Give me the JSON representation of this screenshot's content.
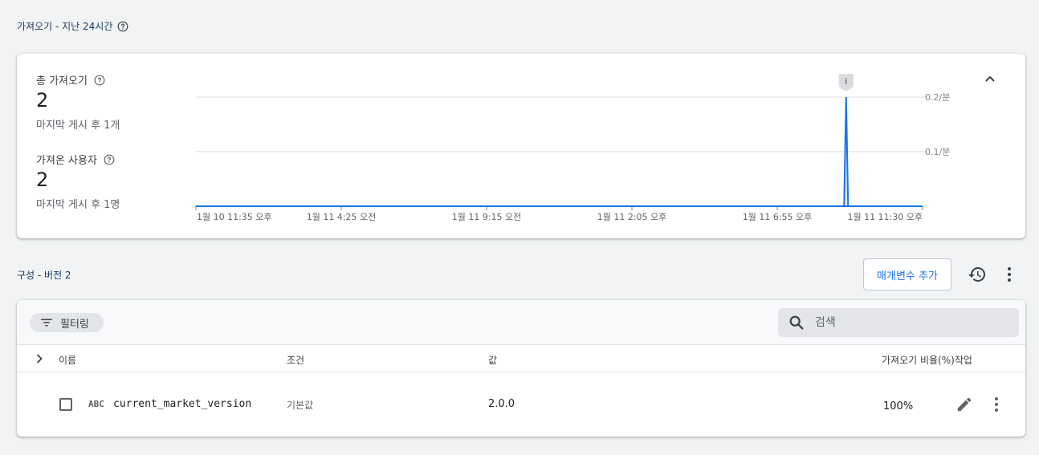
{
  "fetch_section": {
    "title": "가져오기 - 지난 24시간"
  },
  "stats": {
    "total_fetches": {
      "label": "총 가져오기",
      "value": "2",
      "sub": "마지막 게시 후 1개"
    },
    "fetched_users": {
      "label": "가져온 사용자",
      "value": "2",
      "sub": "마지막 게시 후 1명"
    }
  },
  "chart_data": {
    "type": "line",
    "x_tick_labels": [
      "1월 10 11:35 오후",
      "1월 11 4:25 오전",
      "1월 11 9:15 오전",
      "1월 11 2:05 오후",
      "1월 11 6:55 오후",
      "1월 11 11:30 오후"
    ],
    "y_tick_labels": [
      "0.2/분",
      "0.1/분"
    ],
    "y_ticks": [
      0.2,
      0.1
    ],
    "ylim": [
      0,
      0.2
    ],
    "xlim_minutes": [
      0,
      1435
    ],
    "series": [
      {
        "points": [
          [
            0,
            0
          ],
          [
            1280,
            0
          ],
          [
            1284,
            0.2
          ],
          [
            1288,
            0
          ],
          [
            1435,
            0
          ]
        ]
      }
    ],
    "annotation": {
      "label": "i",
      "x_minutes": 1284
    },
    "grid": true,
    "line_color": "#1a73e8"
  },
  "config_section": {
    "title": "구성 - 버전 2",
    "add_param_label": "매개변수 추가"
  },
  "table": {
    "filter_label": "필터링",
    "search_placeholder": "검색",
    "columns": {
      "name": "이름",
      "condition": "조건",
      "value": "값",
      "fetch_pct": "가져오기 비율(%)",
      "actions": "작업"
    },
    "rows": [
      {
        "type_badge": "ABC",
        "name": "current_market_version",
        "condition": "기본값",
        "value": "2.0.0",
        "fetch_pct": "100%"
      }
    ]
  },
  "colors": {
    "accent": "#1a73e8",
    "background": "#f1f3f4"
  }
}
